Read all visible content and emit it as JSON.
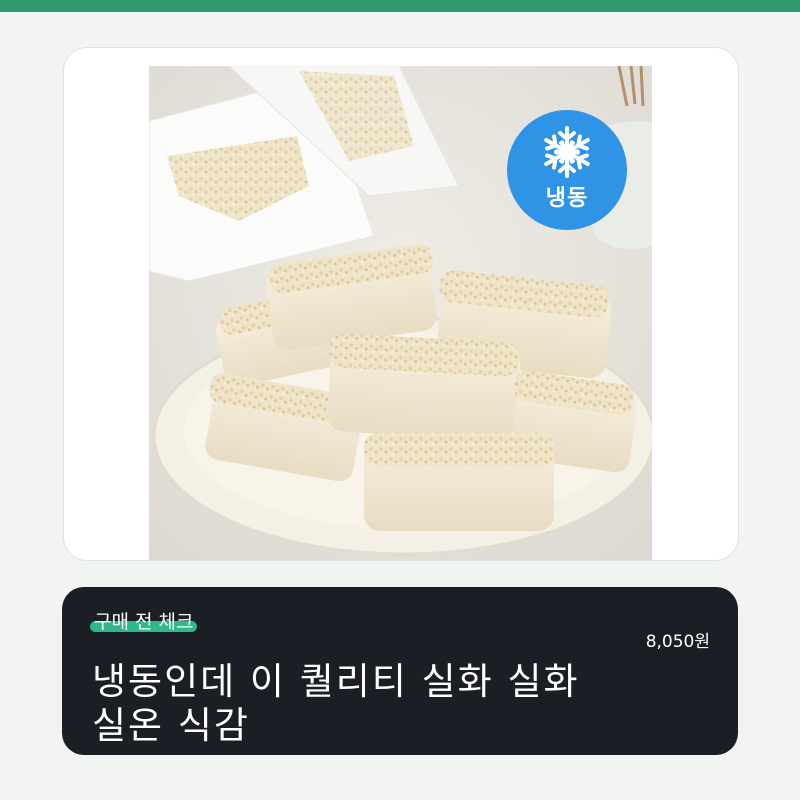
{
  "colors": {
    "top_bar": "#2e9b6e",
    "badge": "#2f93e6",
    "info_bg": "#1b1e24",
    "tag_highlight": "#2fb98a"
  },
  "product": {
    "image_alt": "구매 전 체크 상품 이미지",
    "badge_icon": "snowflake-icon",
    "badge_label": "냉동"
  },
  "info": {
    "tag": "구매 전 체크",
    "price": "8,050원",
    "headline_line1": "냉동인데 이 퀄리티 실화 실화",
    "headline_line2": "실온 식감"
  }
}
